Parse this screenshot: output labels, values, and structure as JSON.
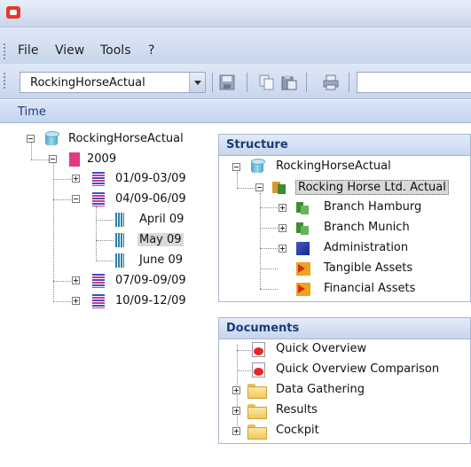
{
  "window": {
    "icon": "app-logo-icon"
  },
  "menu": {
    "file": "File",
    "view": "View",
    "tools": "Tools",
    "help": "?"
  },
  "toolbar": {
    "combo_value": "RockingHorseActual",
    "icons": [
      "save-icon",
      "copy-icon",
      "paste-icon",
      "print-icon"
    ]
  },
  "time": {
    "header": "Time",
    "root": "RockingHorseActual",
    "year": "2009",
    "quarters": [
      "01/09-03/09",
      "04/09-06/09",
      "07/09-09/09",
      "10/09-12/09"
    ],
    "months": [
      "April 09",
      "May 09",
      "June 09"
    ],
    "selected_month": "May 09"
  },
  "structure": {
    "title": "Structure",
    "root": "RockingHorseActual",
    "company": "Rocking Horse Ltd. Actual",
    "children": [
      "Branch Hamburg",
      "Branch Munich",
      "Administration",
      "Tangible Assets",
      "Financial Assets"
    ]
  },
  "documents": {
    "title": "Documents",
    "reports": [
      "Quick Overview",
      "Quick Overview Comparison"
    ],
    "folders": [
      "Data Gathering",
      "Results",
      "Cockpit"
    ]
  }
}
